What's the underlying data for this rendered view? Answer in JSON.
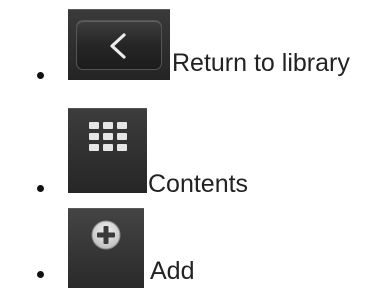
{
  "items": [
    {
      "icon": "back-chevron-icon",
      "label": "Return to library"
    },
    {
      "icon": "grid-icon",
      "label": "Contents"
    },
    {
      "icon": "plus-circle-icon",
      "label": "Add"
    }
  ],
  "colors": {
    "button_dark": "#2a2a2a",
    "button_border": "#555555",
    "icon_glyph": "#e8e8e8",
    "text": "#222222",
    "bullet": "#111111"
  }
}
